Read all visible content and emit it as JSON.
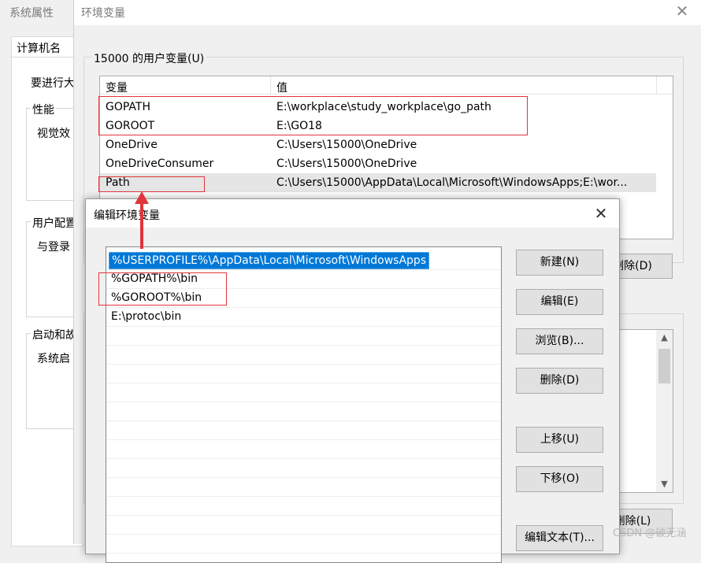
{
  "system_properties": {
    "title": "系统属性",
    "tab_label": "计算机名",
    "text_admin": "要进行大",
    "group_performance": "性能",
    "perf_text": "视觉效",
    "group_profile": "用户配置",
    "profile_text": "与登录",
    "group_startup": "启动和故",
    "startup_text": "系统启"
  },
  "env_window": {
    "title": "环境变量",
    "user_group_label": "15000 的用户变量(U)",
    "col_variable": "变量",
    "col_value": "值",
    "user_vars": [
      {
        "name": "GOPATH",
        "value": "E:\\workplace\\study_workplace\\go_path"
      },
      {
        "name": "GOROOT",
        "value": "E:\\GO18"
      },
      {
        "name": "OneDrive",
        "value": "C:\\Users\\15000\\OneDrive"
      },
      {
        "name": "OneDriveConsumer",
        "value": "C:\\Users\\15000\\OneDrive"
      },
      {
        "name": "Path",
        "value": "C:\\Users\\15000\\AppData\\Local\\Microsoft\\WindowsApps;E:\\wor..."
      }
    ],
    "delete_user_label": "删除(D)",
    "delete_sys_label": "删除(L)"
  },
  "edit_dialog": {
    "title": "编辑环境变量",
    "entries": [
      "%USERPROFILE%\\AppData\\Local\\Microsoft\\WindowsApps",
      "%GOPATH%\\bin",
      "%GOROOT%\\bin",
      "E:\\protoc\\bin"
    ],
    "buttons": {
      "new": "新建(N)",
      "edit": "编辑(E)",
      "browse": "浏览(B)...",
      "delete": "删除(D)",
      "move_up": "上移(U)",
      "move_down": "下移(O)",
      "edit_text": "编辑文本(T)..."
    }
  },
  "watermark": "CSDN @破无涵",
  "colors": {
    "selection": "#0078d7",
    "annotation": "#e0353a"
  }
}
